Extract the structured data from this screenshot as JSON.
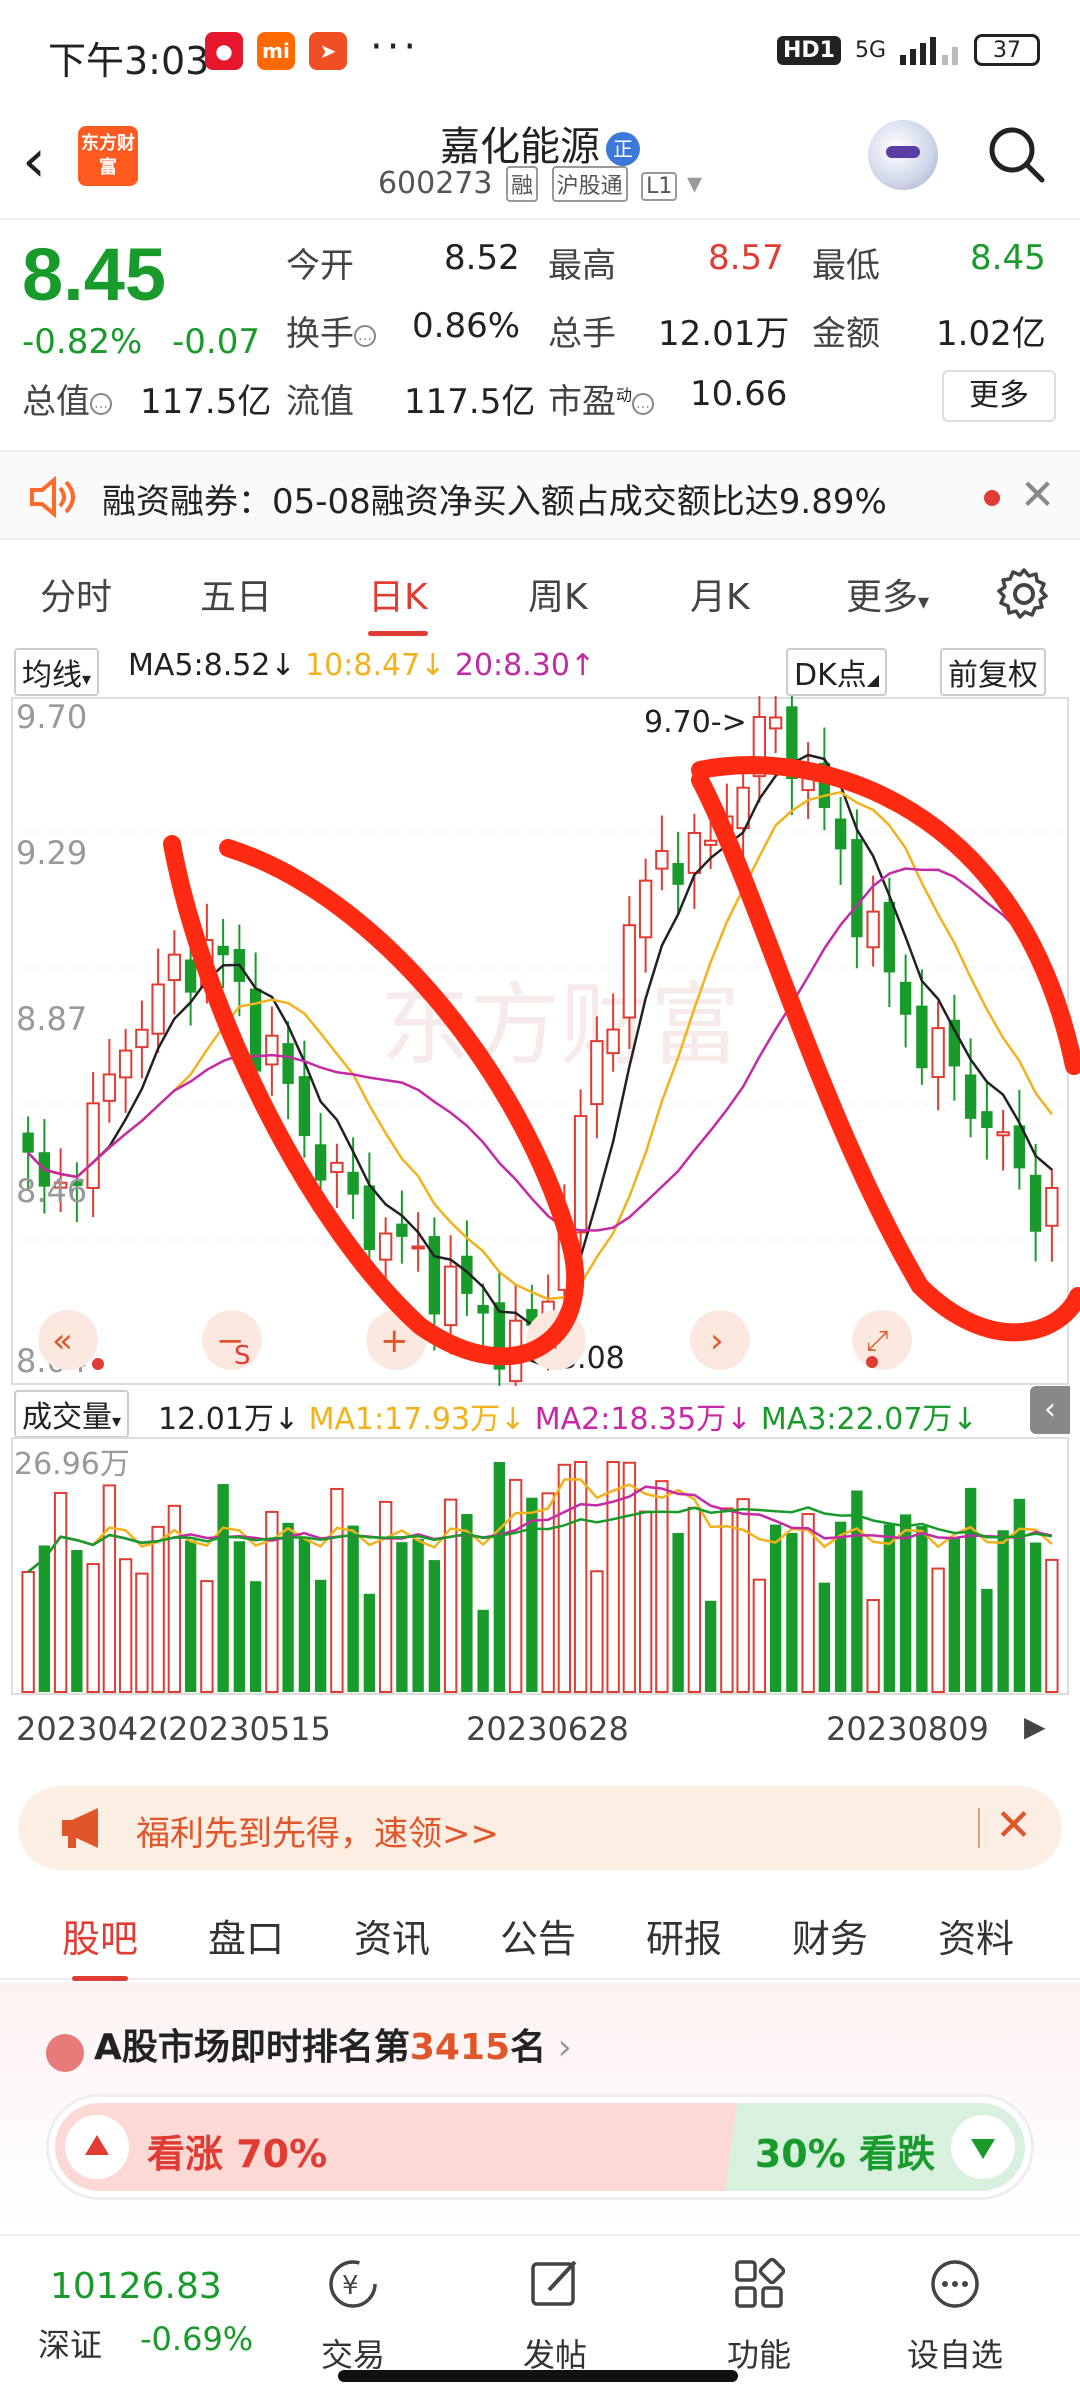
{
  "status_bar": {
    "time": "下午3:03",
    "network": "5G",
    "hd": "HD1",
    "battery": "37"
  },
  "header": {
    "back_icon": "chevron-left-icon",
    "app_logo": "东方财富",
    "stock_name": "嘉化能源",
    "badge": "正",
    "stock_code": "600273",
    "tags": [
      "融",
      "沪股通",
      "L1"
    ],
    "search_icon": "search-icon"
  },
  "quote": {
    "price": "8.45",
    "change_pct": "-0.82%",
    "change": "-0.07",
    "fields": [
      {
        "label": "今开",
        "value": "8.52",
        "color": "#222222"
      },
      {
        "label": "最高",
        "value": "8.57",
        "color": "#e03c33"
      },
      {
        "label": "最低",
        "value": "8.45",
        "color": "#189b2b"
      },
      {
        "label": "换手",
        "value": "0.86%",
        "color": "#222222"
      },
      {
        "label": "总手",
        "value": "12.01万",
        "color": "#222222"
      },
      {
        "label": "金额",
        "value": "1.02亿",
        "color": "#222222"
      },
      {
        "label": "总值",
        "value": "117.5亿",
        "color": "#222222"
      },
      {
        "label": "流值",
        "value": "117.5亿",
        "color": "#222222"
      },
      {
        "label": "市盈",
        "value": "10.66",
        "color": "#222222"
      }
    ],
    "pe_superscript": "动",
    "more_label": "更多"
  },
  "news": {
    "text": "融资融券：05-08融资净买入额占成交额比达9.89%"
  },
  "chart_tabs": [
    "分时",
    "五日",
    "日K",
    "周K",
    "月K",
    "更多"
  ],
  "chart_tabs_active": 2,
  "ma_bar": {
    "avg_label": "均线",
    "ma5": "MA5:8.52",
    "ma10": "10:8.47",
    "ma20": "20:8.30",
    "dk_label": "DK点",
    "adjust_label": "前复权"
  },
  "kchart": {
    "y_labels": [
      "9.70",
      "9.29",
      "8.87",
      "8.46",
      "8.04"
    ],
    "max_label": "9.70->",
    "min_label": "<-8.08",
    "watermark": "东方财富",
    "ctrl_s": "S"
  },
  "volume": {
    "label": "成交量",
    "value": "12.01万",
    "ma1": "MA1:17.93万",
    "ma2": "MA2:18.35万",
    "ma3": "MA3:22.07万",
    "max_label": "26.96万"
  },
  "dates": [
    "20230420",
    "20230515",
    "20230628",
    "20230809"
  ],
  "promo": {
    "text": "福利先到先得，速领>>"
  },
  "info_tabs": [
    "股吧",
    "盘口",
    "资讯",
    "公告",
    "研报",
    "财务",
    "资料"
  ],
  "info_tabs_active": 0,
  "rank": {
    "prefix": "A股市场即时排名第",
    "number": "3415",
    "suffix": "名",
    "up_label": "看涨 70%",
    "down_label": "30% 看跌"
  },
  "bottom_nav": {
    "index_value": "10126.83",
    "index_name": "深证",
    "index_change": "-0.69%",
    "items": [
      "交易",
      "发帖",
      "功能",
      "设自选"
    ]
  },
  "colors": {
    "up": "#e03c33",
    "down": "#189b2b",
    "ma5": "#222222",
    "ma10": "#f2b21c",
    "ma20": "#c42aa6",
    "annotation": "#ff2a12"
  }
}
